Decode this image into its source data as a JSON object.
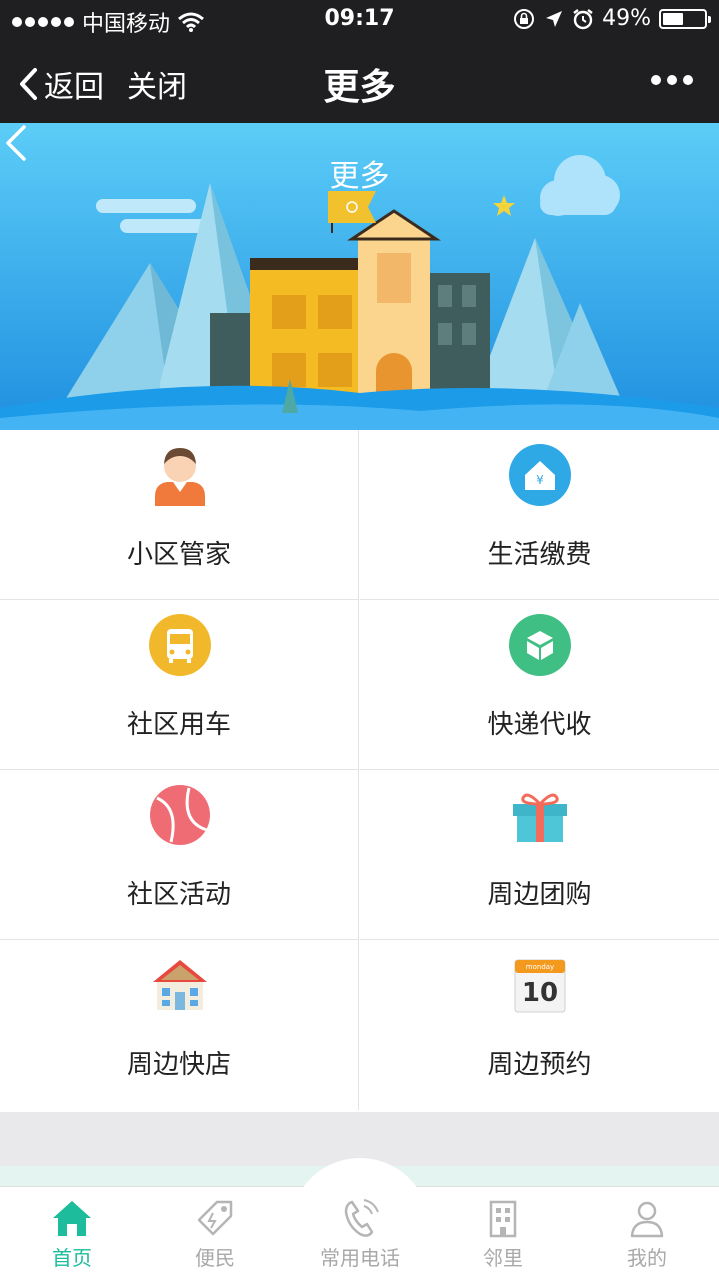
{
  "status_bar": {
    "carrier": "中国移动",
    "time": "09:17",
    "battery_percent": "49%",
    "battery_level": 0.49
  },
  "nav": {
    "back_label": "返回",
    "close_label": "关闭",
    "title": "更多"
  },
  "banner": {
    "title": "更多"
  },
  "grid": {
    "items": [
      {
        "label": "小区管家",
        "icon": "butler-avatar-icon"
      },
      {
        "label": "生活缴费",
        "icon": "payment-house-icon"
      },
      {
        "label": "社区用车",
        "icon": "bus-icon"
      },
      {
        "label": "快递代收",
        "icon": "package-box-icon"
      },
      {
        "label": "社区活动",
        "icon": "ball-icon"
      },
      {
        "label": "周边团购",
        "icon": "gift-icon"
      },
      {
        "label": "周边快店",
        "icon": "shop-icon"
      },
      {
        "label": "周边预约",
        "icon": "calendar-icon",
        "calendar_day": "10",
        "calendar_weekday": "monday"
      }
    ]
  },
  "tabbar": {
    "tabs": [
      {
        "label": "首页",
        "icon": "home-icon",
        "active": true
      },
      {
        "label": "便民",
        "icon": "tag-icon",
        "active": false
      },
      {
        "label": "常用电话",
        "icon": "phone-icon",
        "active": false
      },
      {
        "label": "邻里",
        "icon": "building-icon",
        "active": false
      },
      {
        "label": "我的",
        "icon": "person-icon",
        "active": false
      }
    ]
  },
  "colors": {
    "accent": "#1cbc9c",
    "dark_bar": "#1f1f21",
    "banner_sky": "#2ea3e8"
  }
}
